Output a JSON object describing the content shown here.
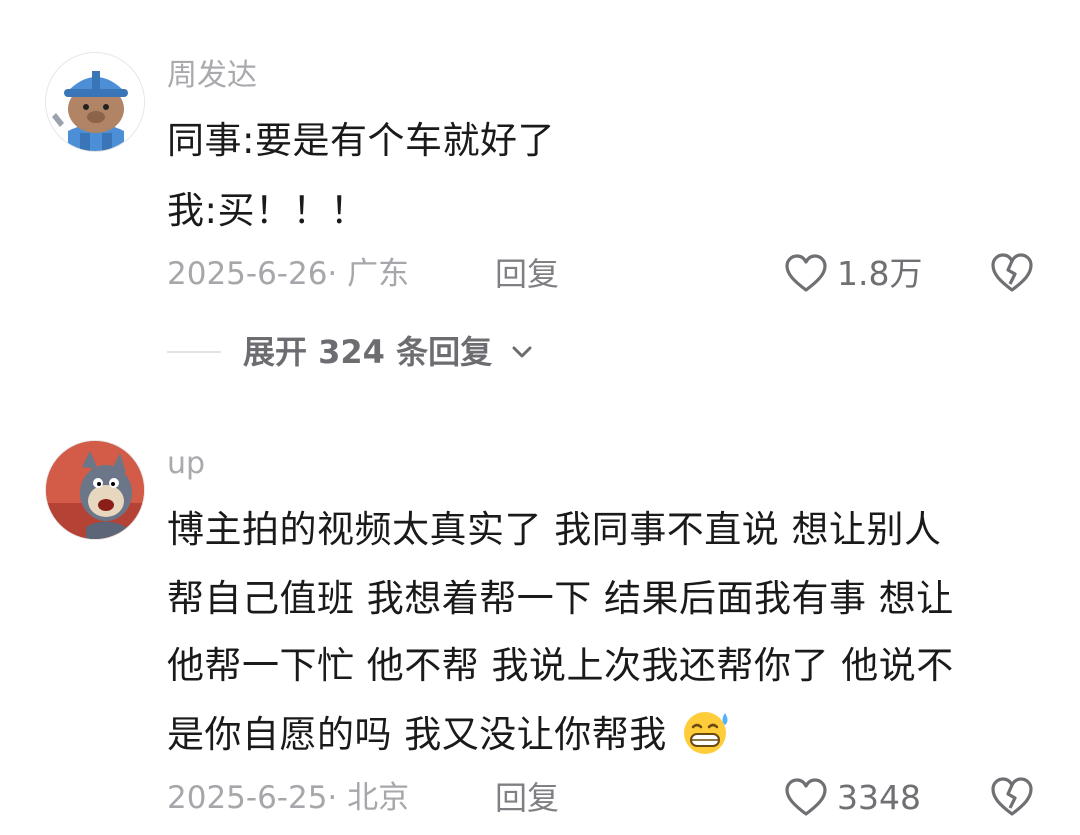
{
  "comments": [
    {
      "username": "周发达",
      "lines": [
        "同事:要是有个车就好了",
        "我:买！！！"
      ],
      "meta": "2025-6-26· 广东",
      "reply_label": "回复",
      "likes": "1.8万"
    },
    {
      "username": "up",
      "lines": [
        "博主拍的视频太真实了 我同事不直说 想让别人",
        "帮自己值班 我想着帮一下 结果后面我有事 想让",
        "他帮一下忙 他不帮 我说上次我还帮你了 他说不",
        "是你自愿的吗 我又没让你帮我"
      ],
      "meta": "2025-6-25· 北京",
      "reply_label": "回复",
      "likes": "3348"
    }
  ],
  "expand_replies": "展开 324 条回复",
  "icons": {
    "like": "heart-outline-icon",
    "dislike": "broken-heart-icon",
    "expand": "chevron-down-icon",
    "emoji": "grinning-sweat-emoji"
  },
  "colors": {
    "text": "#1a1a1a",
    "muted": "#a7a7ab",
    "action": "#6f6f74"
  }
}
